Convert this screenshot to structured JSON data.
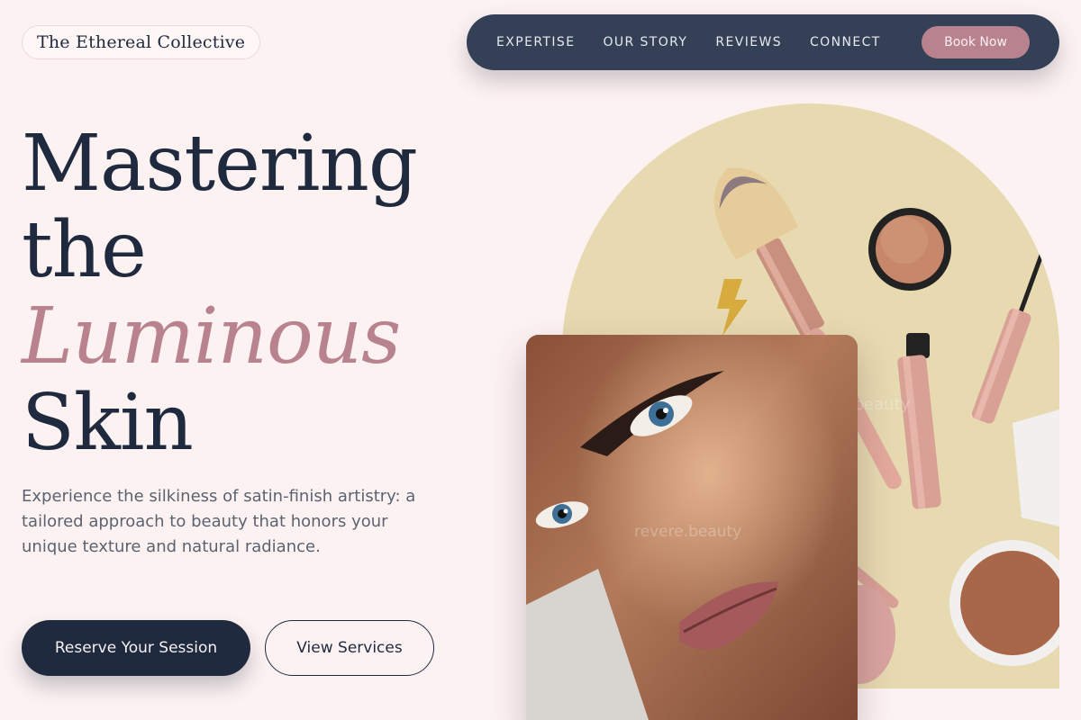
{
  "brand": {
    "name": "The Ethereal Collective"
  },
  "nav": {
    "links": [
      "EXPERTISE",
      "OUR STORY",
      "REVIEWS",
      "CONNECT"
    ],
    "cta": "Book Now"
  },
  "hero": {
    "line1": "Mastering",
    "line2": "the",
    "line3": "Luminous",
    "line4": "Skin",
    "description": "Experience the silkiness of satin-finish artistry: a tailored approach to beauty that honors your unique texture and natural radiance.",
    "primary_button": "Reserve Your Session",
    "secondary_button": "View Services"
  },
  "images": {
    "watermark_arch": "revere.beauty",
    "watermark_portrait": "revere.beauty"
  },
  "colors": {
    "background": "#fdf2f2",
    "navy": "#1f2a3f",
    "nav_bg": "#334055",
    "rose_accent": "#b8838f",
    "arch_bg": "#e7d9b0"
  }
}
